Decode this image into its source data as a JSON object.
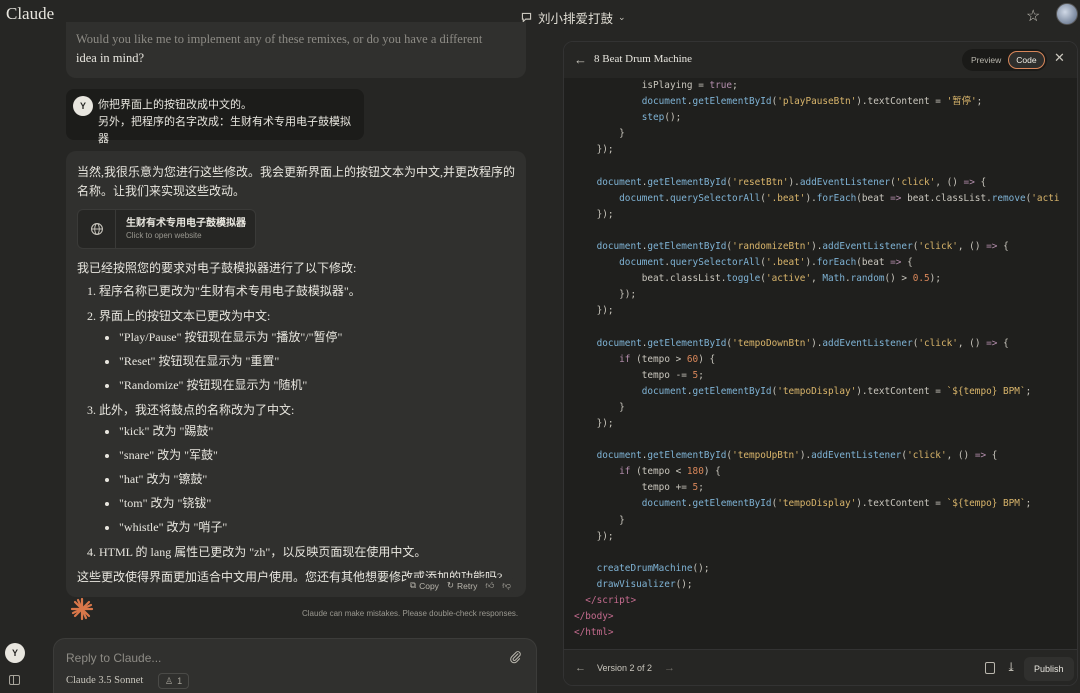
{
  "app": {
    "brand": "Claude",
    "chat_title": "刘小排爱打鼓"
  },
  "chat": {
    "prev_tail": {
      "faded": "Would you like me to implement any of these remixes, or do you have a different",
      "line2": "idea in mind?"
    },
    "user_avatar": "Y",
    "user_msg": {
      "line1": "你把界面上的按钮改成中文的。",
      "line2": "另外，把程序的名字改成：生财有术专用电子鼓模拟器"
    },
    "assistant": {
      "intro": "当然,我很乐意为您进行这些修改。我会更新界面上的按钮文本为中文,并更改程序的名称。让我们来实现这些改动。",
      "artifact": {
        "title": "生财有术专用电子鼓模拟器",
        "subtitle": "Click to open website"
      },
      "summary": "我已经按照您的要求对电子鼓模拟器进行了以下修改:",
      "items": [
        {
          "text": "程序名称已更改为\"生财有术专用电子鼓模拟器\"。",
          "sub": []
        },
        {
          "text": "界面上的按钮文本已更改为中文:",
          "sub": [
            "\"Play/Pause\" 按钮现在显示为 \"播放\"/\"暂停\"",
            "\"Reset\" 按钮现在显示为 \"重置\"",
            "\"Randomize\" 按钮现在显示为 \"随机\""
          ]
        },
        {
          "text": "此外，我还将鼓点的名称改为了中文:",
          "sub": [
            "\"kick\" 改为 \"踢鼓\"",
            "\"snare\" 改为 \"军鼓\"",
            "\"hat\" 改为 \"镲鼓\"",
            "\"tom\" 改为 \"铙钹\"",
            "\"whistle\" 改为 \"哨子\""
          ]
        },
        {
          "text": "HTML 的 lang 属性已更改为 \"zh\"，以反映页面现在使用中文。",
          "sub": []
        }
      ],
      "closing": "这些更改使得界面更加适合中文用户使用。您还有其他想要修改或添加的功能吗?",
      "actions": {
        "copy": "Copy",
        "retry": "Retry"
      }
    },
    "disclaimer": "Claude can make mistakes. Please double-check responses.",
    "composer": {
      "placeholder": "Reply to Claude...",
      "model": "Claude 3.5 Sonnet",
      "badge_count": "1"
    }
  },
  "artifact_panel": {
    "title": "8 Beat Drum Machine",
    "tabs": {
      "preview": "Preview",
      "code": "Code"
    },
    "active_tab": "Code",
    "version": "Version 2 of 2",
    "publish": "Publish"
  },
  "colors": {
    "accent": "#d9875a",
    "background": "#262624",
    "panel": "#1f1f1d"
  }
}
